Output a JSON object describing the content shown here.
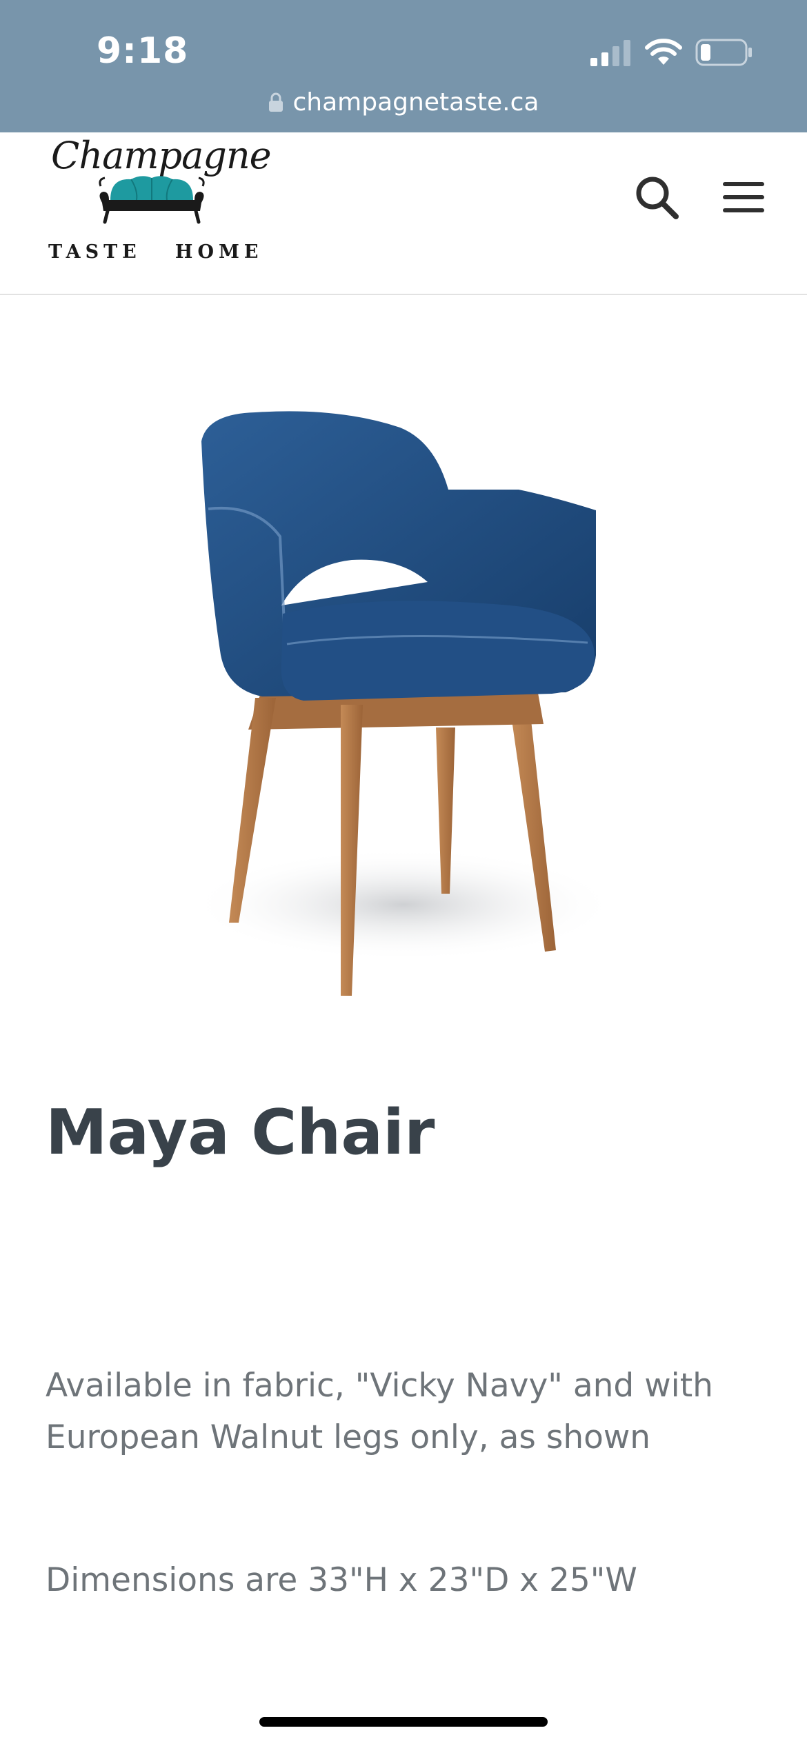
{
  "status_bar": {
    "time": "9:18",
    "url": "champagnetaste.ca",
    "icons": [
      "signal-icon",
      "wifi-icon",
      "battery-icon",
      "lock-icon"
    ],
    "background": "#7895ab"
  },
  "header": {
    "logo_script": "Champagne",
    "logo_subtitle": "TASTE   HOME",
    "logo_accent": "#1e9aa0",
    "icons": [
      "search-icon",
      "menu-icon"
    ]
  },
  "product": {
    "title": "Maya Chair",
    "description": "Available in fabric, \"Vicky Navy\" and with European Walnut legs only, as shown",
    "dimensions": "Dimensions are 33\"H x 23\"D x 25\"W",
    "fabric_color": "#1f4f85",
    "leg_color": "#b57b4a"
  }
}
